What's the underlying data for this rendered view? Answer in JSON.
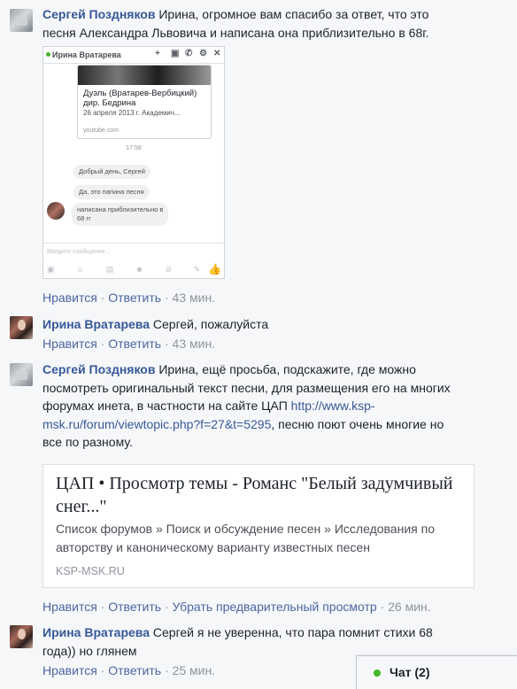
{
  "comments": [
    {
      "author": "Сергей Поздняков",
      "lines": [
        "Ирина, огромное вам спасибо за ответ, что это",
        "песня Александра Львовича и написана она приблизительно в 68г."
      ],
      "actions": [
        "Нравится",
        "Ответить"
      ],
      "time": "43 мин."
    },
    {
      "author": "Ирина Вратарева",
      "text": "Сергей, пожалуйста",
      "actions": [
        "Нравится",
        "Ответить"
      ],
      "time": "43 мин."
    },
    {
      "author": "Сергей Поздняков",
      "lines": [
        "Ирина, ещё просьба, подскажите, где можно",
        "посмотреть оригинальный текст песни, для размещения его на многих",
        "форумах инета, в частности на сайте ЦАП"
      ],
      "link_a": "http://www.ksp-",
      "link_b": "msk.ru/forum/viewtopic.php?f=27&t=5295",
      "after_link": ", песню поют очень многие но",
      "last_line": "все по разному.",
      "actions": [
        "Нравится",
        "Ответить",
        "Убрать предварительный просмотр"
      ],
      "time": "26 мин."
    },
    {
      "author": "Ирина Вратарева",
      "text_a": "Сергей я не уверенна, что пара помнит стихи 68",
      "text_b": "года)) но глянем",
      "actions": [
        "Нравится",
        "Ответить"
      ],
      "time": "25 мин."
    }
  ],
  "screenshot": {
    "header_name": "Ирина Вратарева",
    "header_icons": [
      "+",
      "▣",
      "✆",
      "⚙",
      "✕"
    ],
    "card_title": "Дуэль (Вратарев-Вербицкий) дир. Бедрина",
    "card_date": "26 апреля 2013 г. Академич...",
    "card_url": "youtube.com",
    "time": "17:58",
    "bubbles": [
      "Добрый день, Сергей",
      "Да, это папина песня",
      "написана приблизительно в",
      "68 гг"
    ],
    "placeholder": "Введите сообщение...",
    "tools": "▣ ☺ ▤ ☻ ⊘ ✎",
    "like": "👍"
  },
  "preview": {
    "title": "ЦАП • Просмотр темы - Романс \"Белый задумчивый снег...\"",
    "description": "Список форумов » Поиск и обсуждение песен » Исследования по авторству и каноническому варианту известных песен",
    "domain": "KSP-MSK.RU"
  },
  "chat": {
    "label": "Чат (2)",
    "status_color": "#42b72a"
  },
  "separator": " · "
}
